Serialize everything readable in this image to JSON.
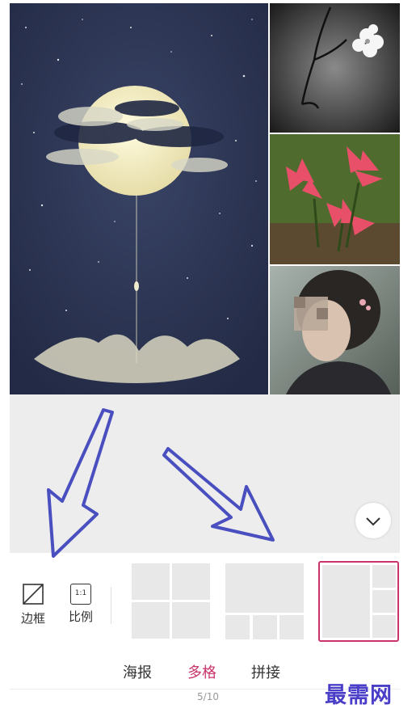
{
  "collage": {
    "photos": [
      {
        "name": "moon-girl",
        "desc_icon": "moon-photo"
      },
      {
        "name": "plum-blossom",
        "desc_icon": "orchid-photo"
      },
      {
        "name": "red-lilies",
        "desc_icon": "lily-photo"
      },
      {
        "name": "portrait",
        "desc_icon": "portrait-photo"
      }
    ]
  },
  "tools": {
    "border": {
      "label": "边框",
      "icon": "border-slash-icon"
    },
    "ratio": {
      "label": "比例",
      "icon_text": "1:1"
    }
  },
  "layouts": [
    {
      "name": "grid-2x2",
      "selected": false
    },
    {
      "name": "one-top-three-bottom",
      "selected": false
    },
    {
      "name": "one-left-three-right",
      "selected": true
    }
  ],
  "tabs": [
    {
      "label": "海报",
      "active": false
    },
    {
      "label": "多格",
      "active": true
    },
    {
      "label": "拼接",
      "active": false
    }
  ],
  "page_indicator": "5/10",
  "watermark": "最需网",
  "colors": {
    "accent": "#c8336b",
    "arrow": "#4a4fc0"
  }
}
